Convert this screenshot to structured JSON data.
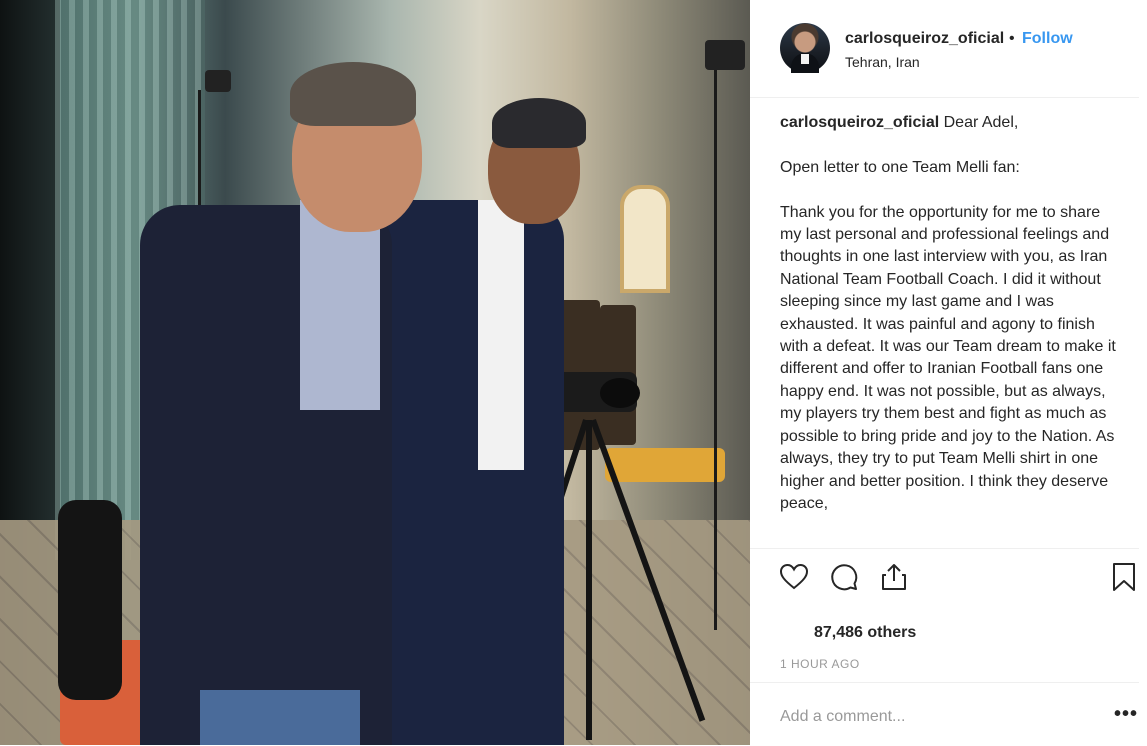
{
  "post": {
    "photo_alt": "Two men laughing in front of a camera on a tripod in a studio",
    "header": {
      "username": "carlosqueiroz_oficial",
      "separator": "•",
      "follow_label": "Follow",
      "location": "Tehran, Iran"
    },
    "caption": {
      "username": "carlosqueiroz_oficial",
      "text": " Dear Adel,\n\nOpen letter to one Team Melli fan:\n\nThank you for the opportunity for me to share my last personal and professional feelings and thoughts in one last interview with you, as Iran National Team Football Coach. I did it without sleeping since my last game and I was exhausted. It was painful and agony to finish with a defeat. It was our Team dream to make it different and offer to Iranian Football fans one happy end. It was not possible, but as always, my players try them best and fight as much as possible to bring pride and joy to the Nation. As always, they try to put Team Melli shirt in one higher and better position. I think they deserve peace,"
    },
    "actions": {
      "like_icon": "heart-icon",
      "comment_icon": "comment-icon",
      "share_icon": "share-icon",
      "save_icon": "bookmark-icon"
    },
    "likes_text": "87,486 others",
    "timestamp": "1 HOUR AGO",
    "comment_placeholder": "Add a comment...",
    "more_label": "•••",
    "colors": {
      "accent": "#3897f0",
      "text": "#262626",
      "muted": "#999999",
      "divider": "#efefef"
    }
  }
}
